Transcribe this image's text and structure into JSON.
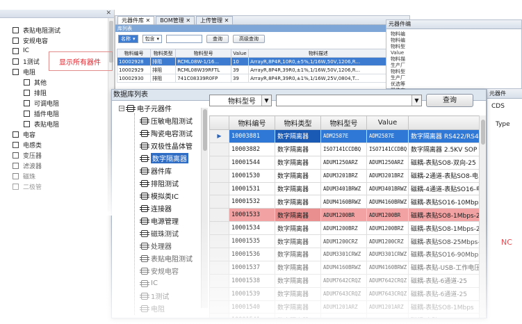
{
  "back_tree": {
    "items": [
      {
        "label": "表贴电阻测试",
        "sub": false
      },
      {
        "label": "安规电容",
        "sub": false
      },
      {
        "label": "IC",
        "sub": false
      },
      {
        "label": "1测试",
        "sub": false
      },
      {
        "label": "电阻",
        "sub": false
      },
      {
        "label": "其他",
        "sub": true
      },
      {
        "label": "排阻",
        "sub": true
      },
      {
        "label": "可调电阻",
        "sub": true
      },
      {
        "label": "插件电阻",
        "sub": true
      },
      {
        "label": "表贴电阻",
        "sub": true
      },
      {
        "label": "电容",
        "sub": false
      },
      {
        "label": "电感类",
        "sub": false
      },
      {
        "label": "变压器",
        "sub": false
      },
      {
        "label": "滤波器",
        "sub": false
      },
      {
        "label": "磁珠",
        "sub": false
      },
      {
        "label": "二极管",
        "sub": false
      }
    ],
    "bottom_label": "元器件库"
  },
  "annotation": "显示所有器件",
  "bom_window": {
    "tabs": [
      "元器件库",
      "BOM管理",
      "上传管理"
    ],
    "band": "库列表",
    "filter_value": "名称",
    "package_value": "包含",
    "query_label": "查询",
    "advanced_label": "高级查询",
    "columns": [
      "物料编号",
      "物料类型",
      "物料型号",
      "Value",
      "物料描述",
      "生产厂"
    ],
    "rows": [
      [
        "10002928",
        "排阻",
        "RCML08W-1/16...",
        "10",
        "ArrayR,8P4R,10R0,±5%,1/16W,50V,1206,R...",
        "风华"
      ],
      [
        "10002929",
        "排阻",
        "RCML08W39RFTL",
        "39",
        "ArrayR,8P4R,39R0,±1%,1/16W,50V,1206,R...",
        "风华"
      ],
      [
        "10002930",
        "排阻",
        "741C08339R0FP",
        "39",
        "ArrayR,8P4R,39R0,±1%,1/16W,25V,0804,T...",
        "CTS"
      ]
    ]
  },
  "right_back": {
    "title": "元器件编",
    "lines": [
      "物料编",
      "物料编",
      "物料型",
      "Value",
      "物料描",
      "生产厂",
      "物料型",
      "生产厂",
      "优选等",
      "器件库"
    ]
  },
  "far_right": {
    "title": "元器件",
    "cds": "CDS",
    "type": "Type",
    "no": "NC"
  },
  "front": {
    "title": "数据库列表",
    "tree": [
      {
        "label": "电子元器件",
        "level": 0
      },
      {
        "label": "压敏电阻测试",
        "level": 1
      },
      {
        "label": "陶瓷电容测试",
        "level": 1
      },
      {
        "label": "双极性晶体管",
        "level": 1
      },
      {
        "label": "数字隔离器",
        "level": 1,
        "highlight": true
      },
      {
        "label": "器件库",
        "level": 1
      },
      {
        "label": "排阻测试",
        "level": 1
      },
      {
        "label": "模拟类IC",
        "level": 1
      },
      {
        "label": "连接器",
        "level": 1
      },
      {
        "label": "电源管理",
        "level": 1
      },
      {
        "label": "磁珠测试",
        "level": 1
      },
      {
        "label": "处理器",
        "level": 1
      },
      {
        "label": "表贴电阻测试",
        "level": 1
      },
      {
        "label": "安规电容",
        "level": 1
      },
      {
        "label": "IC",
        "level": 1
      },
      {
        "label": "1测试",
        "level": 1
      },
      {
        "label": "电阻",
        "level": 1
      }
    ],
    "search_field": "物料型号",
    "query_label": "查询",
    "columns": [
      "物料编号",
      "物料类型",
      "物料型号",
      "Value",
      ""
    ],
    "rows": [
      {
        "id": "10003881",
        "type": "数字隔离器",
        "model": "ADM2587E",
        "value": "ADM2587E",
        "desc": "数字隔离器 RS422/RS485",
        "state": "selected"
      },
      {
        "id": "10003882",
        "type": "数字隔离器",
        "model": "ISO7141CCDBQ",
        "value": "ISO7141CCDBQ",
        "desc": "数字隔离器 2.5KV SOP",
        "state": ""
      },
      {
        "id": "10001544",
        "type": "数字隔离器",
        "model": "ADUM1250ARZ",
        "value": "ADUM1250ARZ",
        "desc": "磁耦-表贴SO8-双向-25",
        "state": ""
      },
      {
        "id": "10001530",
        "type": "数字隔离器",
        "model": "ADUM3201BRZ",
        "value": "ADUM3201BRZ",
        "desc": "磁耦-2通道-表贴SO8-电",
        "state": ""
      },
      {
        "id": "10001531",
        "type": "数字隔离器",
        "model": "ADUM3401BRWZ",
        "value": "ADUM3401BRWZ",
        "desc": "磁耦-4通道-表贴SO16-电",
        "state": ""
      },
      {
        "id": "10001532",
        "type": "数字隔离器",
        "model": "ADUM4160BRWZ",
        "value": "ADUM4160BRWZ",
        "desc": "磁耦-表贴SO16-10Mbps-2",
        "state": ""
      },
      {
        "id": "10001533",
        "type": "数字隔离器",
        "model": "ADUM1200BR",
        "value": "ADUM1200BR",
        "desc": "磁耦-表贴SO8-1Mbps-25",
        "state": "pink"
      },
      {
        "id": "10001534",
        "type": "数字隔离器",
        "model": "ADUM1200BRZ",
        "value": "ADUM1200BRZ",
        "desc": "磁耦-表贴SO8-1Mbps-25",
        "state": ""
      },
      {
        "id": "10001535",
        "type": "数字隔离器",
        "model": "ADUM1200CRZ",
        "value": "ADUM1200CRZ",
        "desc": "磁耦-表贴SO8-25Mbps-2",
        "state": ""
      },
      {
        "id": "10001536",
        "type": "数字隔离器",
        "model": "ADUM3301CRWZ",
        "value": "ADUM3301CRWZ",
        "desc": "磁耦-表贴SO16-90Mbps-2",
        "state": ""
      },
      {
        "id": "10001537",
        "type": "数字隔离器",
        "model": "ADUM4160BRWZ",
        "value": "ADUM4160BRWZ",
        "desc": "磁耦-表贴-USB-工作电压",
        "state": ""
      },
      {
        "id": "10001538",
        "type": "数字隔离器",
        "model": "ADUM7642CRQZ",
        "value": "ADUM7642CRQZ",
        "desc": "磁耦-表贴-6通道-25",
        "state": ""
      },
      {
        "id": "10001539",
        "type": "数字隔离器",
        "model": "ADUM7643CRQZ",
        "value": "ADUM7643CRQZ",
        "desc": "磁耦-表贴-6通道-25",
        "state": ""
      },
      {
        "id": "10001540",
        "type": "数字隔离器",
        "model": "ADUM1201ARZ",
        "value": "ADUM1201ARZ",
        "desc": "磁耦-表贴SO8-1Mbps",
        "state": ""
      },
      {
        "id": "10001541",
        "type": "数字隔离器",
        "model": "ADUM1201BRZ",
        "value": "ADUM1201BRZ",
        "desc": "磁耦-表贴SO8-10Mbps",
        "state": ""
      }
    ]
  }
}
